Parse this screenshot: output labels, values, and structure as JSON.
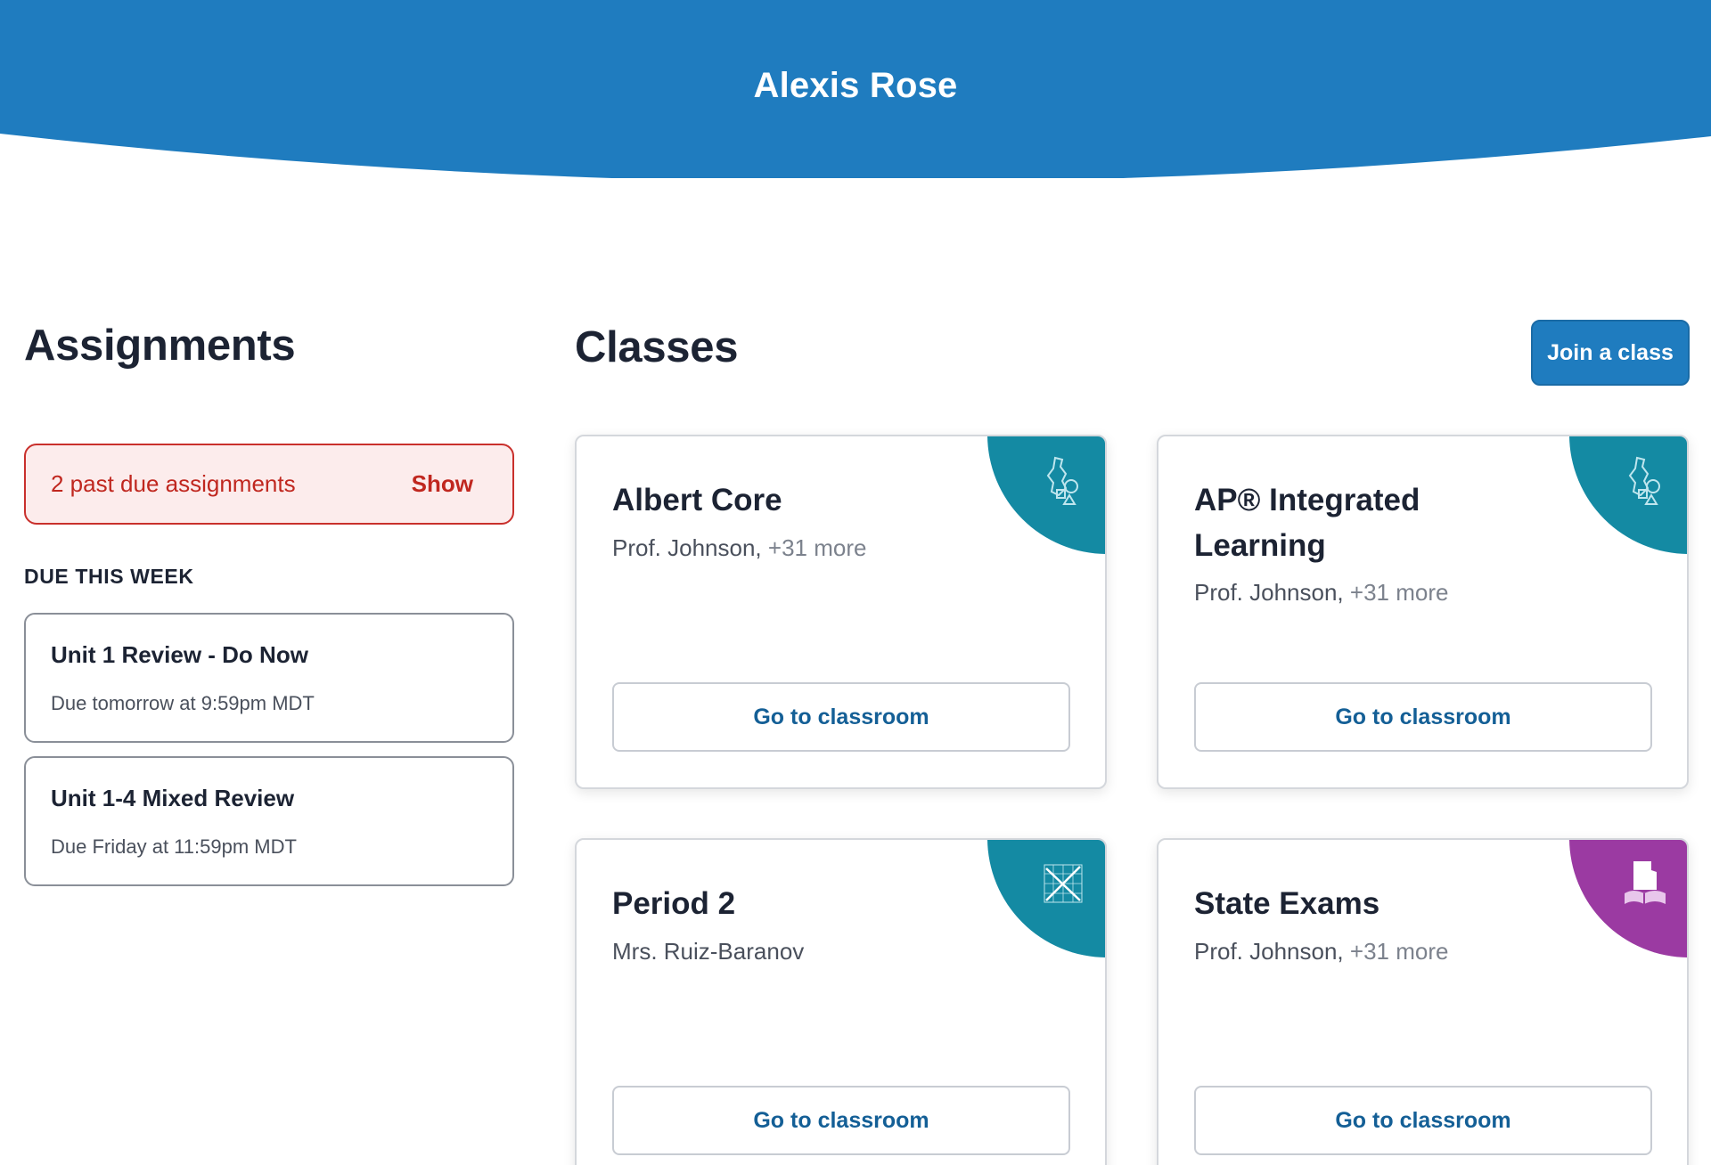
{
  "header": {
    "title": "Alexis Rose",
    "color": "#1f7cbf"
  },
  "assignments": {
    "title": "Assignments",
    "past_due": {
      "text": "2 past due assignments",
      "action": "Show"
    },
    "due_label": "DUE THIS WEEK",
    "items": [
      {
        "name": "Unit 1 Review - Do Now",
        "due": "Due tomorrow at 9:59pm MDT"
      },
      {
        "name": "Unit 1-4 Mixed Review",
        "due": "Due Friday at 11:59pm MDT"
      }
    ]
  },
  "classes": {
    "title": "Classes",
    "join_label": "Join a class",
    "items": [
      {
        "name": "Albert Core",
        "teacher": "Prof. Johnson,",
        "more": " +31 more",
        "button": "Go to classroom",
        "corner_color": "#148aa3",
        "icon": "state-map-icon"
      },
      {
        "name": "AP® Integrated Learning",
        "teacher": "Prof. Johnson,",
        "more": " +31 more",
        "button": "Go to classroom",
        "corner_color": "#148aa3",
        "icon": "state-map-icon"
      },
      {
        "name": "Period 2",
        "teacher": "Mrs. Ruiz-Baranov",
        "more": "",
        "button": "Go to classroom",
        "corner_color": "#148aa3",
        "icon": "graph-icon"
      },
      {
        "name": "State Exams",
        "teacher": "Prof. Johnson,",
        "more": " +31 more",
        "button": "Go to classroom",
        "corner_color": "#9b3aa2",
        "icon": "state-book-icon"
      }
    ]
  }
}
